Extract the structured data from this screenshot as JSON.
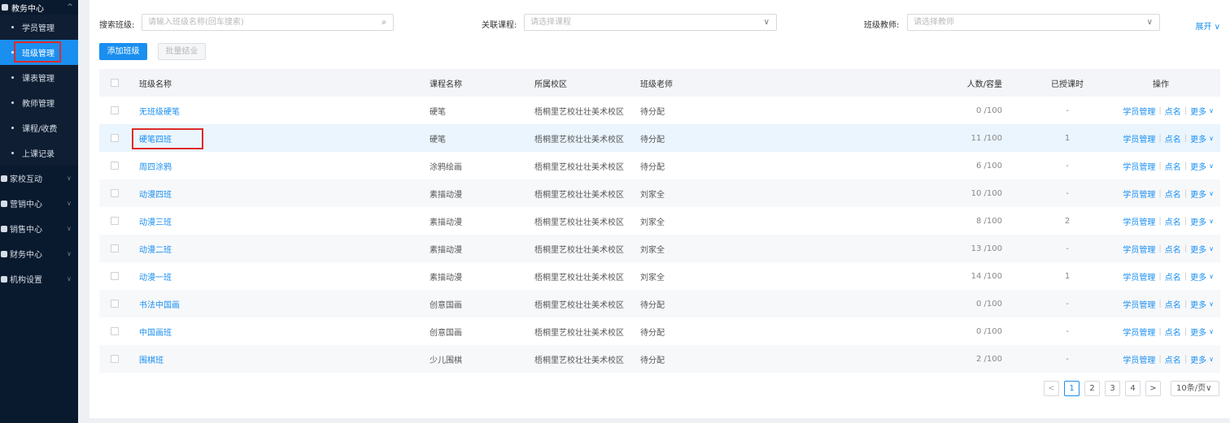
{
  "sidebar": {
    "header": {
      "label": "教务中心",
      "chevron": "^"
    },
    "subitems": [
      {
        "label": "学员管理",
        "active": false
      },
      {
        "label": "班级管理",
        "active": true
      },
      {
        "label": "课表管理",
        "active": false
      },
      {
        "label": "教师管理",
        "active": false
      },
      {
        "label": "课程/收费",
        "active": false
      },
      {
        "label": "上课记录",
        "active": false
      }
    ],
    "groups": [
      {
        "label": "家校互动",
        "icon": "home-school-icon"
      },
      {
        "label": "营销中心",
        "icon": "marketing-icon"
      },
      {
        "label": "销售中心",
        "icon": "sales-icon"
      },
      {
        "label": "财务中心",
        "icon": "finance-icon"
      },
      {
        "label": "机构设置",
        "icon": "settings-gear-icon"
      }
    ]
  },
  "filters": {
    "search_label": "搜索班级:",
    "search_placeholder": "请输入班级名称(回车搜索)",
    "course_label": "关联课程:",
    "course_placeholder": "请选择课程",
    "teacher_label": "班级教师:",
    "teacher_placeholder": "请选择教师",
    "expand_label": "展开 ∨"
  },
  "toolbar": {
    "add_label": "添加班级",
    "batch_label": "批量结业"
  },
  "table": {
    "headers": {
      "name": "班级名称",
      "course": "课程名称",
      "campus": "所属校区",
      "teacher": "班级老师",
      "count": "人数/容量",
      "taught": "已授课时",
      "ops": "操作"
    },
    "op_labels": {
      "students": "学员管理",
      "roll": "点名",
      "more": "更多"
    },
    "rows": [
      {
        "name": "无班级硬笔",
        "course": "硬笔",
        "campus": "梧桐里艺校壮壮美术校区",
        "teacher": "待分配",
        "count": "0 /100",
        "taught": "-"
      },
      {
        "name": "硬笔四班",
        "course": "硬笔",
        "campus": "梧桐里艺校壮壮美术校区",
        "teacher": "待分配",
        "count": "11 /100",
        "taught": "1"
      },
      {
        "name": "周四涂鸦",
        "course": "涂鸦绘画",
        "campus": "梧桐里艺校壮壮美术校区",
        "teacher": "待分配",
        "count": "6 /100",
        "taught": "-"
      },
      {
        "name": "动漫四班",
        "course": "素描动漫",
        "campus": "梧桐里艺校壮壮美术校区",
        "teacher": "刘家全",
        "count": "10 /100",
        "taught": "-"
      },
      {
        "name": "动漫三班",
        "course": "素描动漫",
        "campus": "梧桐里艺校壮壮美术校区",
        "teacher": "刘家全",
        "count": "8 /100",
        "taught": "2"
      },
      {
        "name": "动漫二班",
        "course": "素描动漫",
        "campus": "梧桐里艺校壮壮美术校区",
        "teacher": "刘家全",
        "count": "13 /100",
        "taught": "-"
      },
      {
        "name": "动漫一班",
        "course": "素描动漫",
        "campus": "梧桐里艺校壮壮美术校区",
        "teacher": "刘家全",
        "count": "14 /100",
        "taught": "1"
      },
      {
        "name": "书法中国画",
        "course": "创意国画",
        "campus": "梧桐里艺校壮壮美术校区",
        "teacher": "待分配",
        "count": "0 /100",
        "taught": "-"
      },
      {
        "name": "中国画班",
        "course": "创意国画",
        "campus": "梧桐里艺校壮壮美术校区",
        "teacher": "待分配",
        "count": "0 /100",
        "taught": "-"
      },
      {
        "name": "围棋班",
        "course": "少儿围棋",
        "campus": "梧桐里艺校壮壮美术校区",
        "teacher": "待分配",
        "count": "2 /100",
        "taught": "-"
      }
    ]
  },
  "pagination": {
    "prev": "<",
    "pages": [
      "1",
      "2",
      "3",
      "4"
    ],
    "current": "1",
    "next": ">",
    "page_size": "10条/页∨"
  },
  "colors": {
    "accent": "#1a8ff0",
    "highlight": "#e02a2a",
    "sidebar_bg": "#0a1a2e"
  }
}
